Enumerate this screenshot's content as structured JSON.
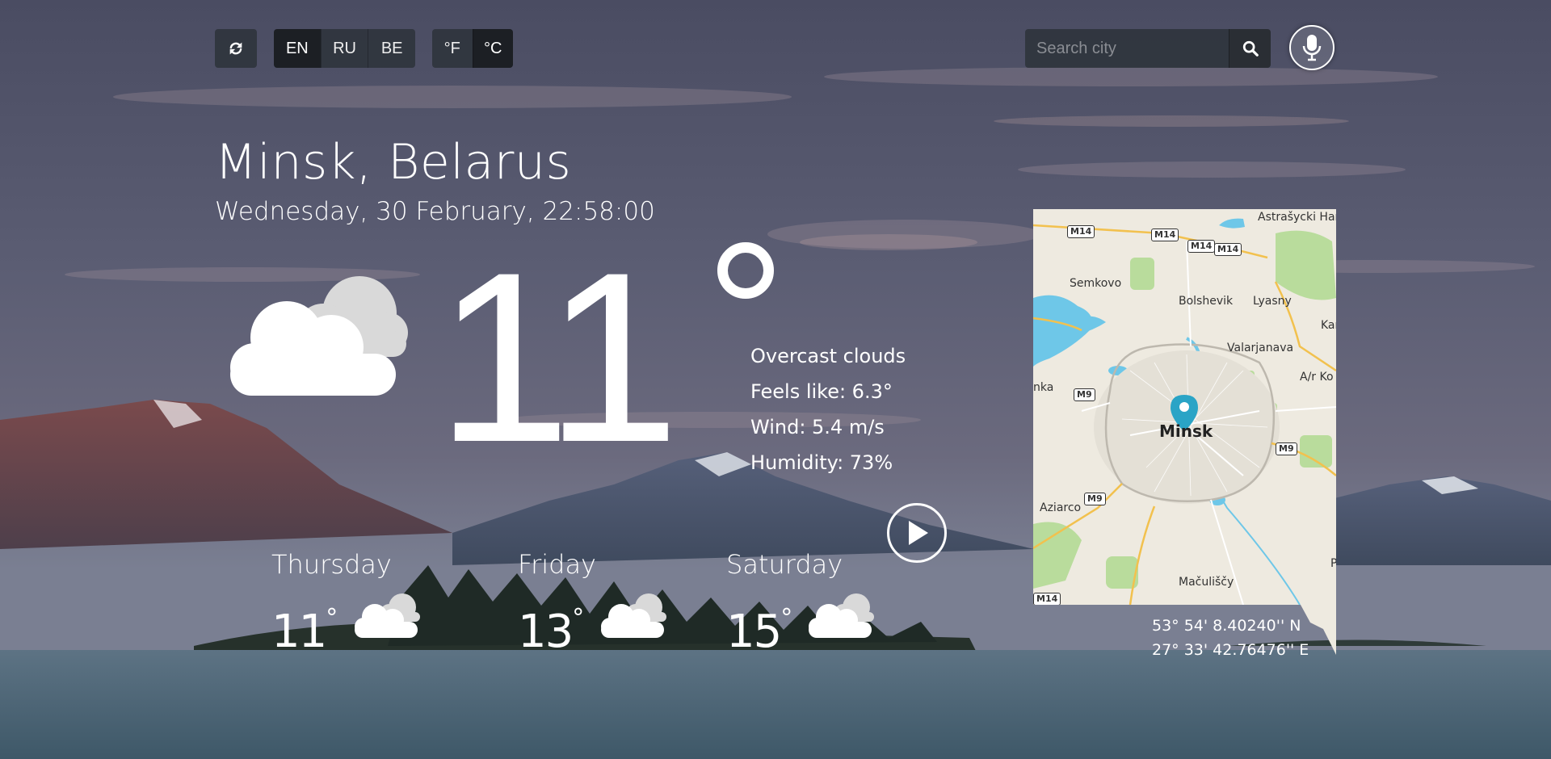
{
  "toolbar": {
    "refresh_icon": "refresh-icon",
    "languages": [
      {
        "label": "EN",
        "active": true
      },
      {
        "label": "RU",
        "active": false
      },
      {
        "label": "BE",
        "active": false
      }
    ],
    "units": [
      {
        "label": "°F",
        "active": false
      },
      {
        "label": "°C",
        "active": true
      }
    ],
    "search": {
      "placeholder": "Search city",
      "value": "",
      "icon": "search-icon"
    },
    "mic_icon": "microphone-icon"
  },
  "location": {
    "title": "Minsk, Belarus",
    "datetime": "Wednesday, 30 February, 22:58:00"
  },
  "current": {
    "temperature": "11",
    "icon": "cloud-icon",
    "details": {
      "description": "Overcast clouds",
      "feels_like": "Feels like: 6.3°",
      "wind": "Wind: 5.4 m/s",
      "humidity": "Humidity: 73%"
    },
    "play_icon": "play-icon"
  },
  "forecast": [
    {
      "day": "Thursday",
      "temp": "11",
      "icon": "cloud-icon"
    },
    {
      "day": "Friday",
      "temp": "13",
      "icon": "cloud-icon"
    },
    {
      "day": "Saturday",
      "temp": "15",
      "icon": "cloud-icon"
    }
  ],
  "map": {
    "city_label": "Minsk",
    "places": [
      "Astrašycki Haradok",
      "Semkovo",
      "Bolshevik",
      "Lyasny",
      "Valarjanava",
      "A/r Ko",
      "Kar",
      "nka",
      "Aziarco",
      "Mačuliščy",
      "P"
    ],
    "roads": [
      "M14",
      "M14",
      "M14",
      "M14",
      "M9",
      "M9",
      "M9",
      "M14"
    ],
    "marker_icon": "map-pin-icon"
  },
  "coordinates": {
    "lat": "53° 54' 8.40240'' N",
    "lon": "27° 33' 42.76476'' E"
  },
  "colors": {
    "button_bg": "#2d323a",
    "button_active": "#191c21",
    "map_land": "#eeeae0",
    "map_water": "#6ec7e8",
    "map_green": "#b9dc9c",
    "marker": "#2aa4c6"
  }
}
